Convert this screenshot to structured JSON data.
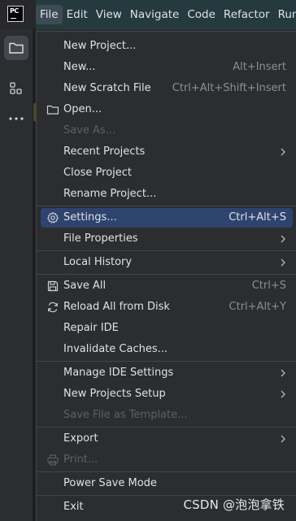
{
  "menubar": {
    "items": [
      {
        "label": "File",
        "active": true
      },
      {
        "label": "Edit"
      },
      {
        "label": "View"
      },
      {
        "label": "Navigate"
      },
      {
        "label": "Code"
      },
      {
        "label": "Refactor"
      },
      {
        "label": "Run"
      }
    ]
  },
  "app_logo": {
    "text": "PC"
  },
  "toolwindow": {
    "icons": [
      "folder-icon",
      "structure-icon",
      "more-icon"
    ]
  },
  "file_menu": {
    "items": [
      {
        "label": "New Project...",
        "shortcut": "",
        "submenu": false
      },
      {
        "label": "New...",
        "shortcut": "Alt+Insert",
        "submenu": false
      },
      {
        "label": "New Scratch File",
        "shortcut": "Ctrl+Alt+Shift+Insert",
        "submenu": false
      },
      {
        "label": "Open...",
        "shortcut": "",
        "icon": "folder-icon"
      },
      {
        "label": "Save As...",
        "shortcut": "",
        "disabled": true
      },
      {
        "label": "Recent Projects",
        "submenu": true
      },
      {
        "label": "Close Project"
      },
      {
        "label": "Rename Project..."
      },
      {
        "label": "Settings...",
        "shortcut": "Ctrl+Alt+S",
        "icon": "gear-icon",
        "selected": true
      },
      {
        "label": "File Properties",
        "submenu": true
      },
      {
        "label": "Local History",
        "submenu": true
      },
      {
        "label": "Save All",
        "shortcut": "Ctrl+S",
        "icon": "save-icon"
      },
      {
        "label": "Reload All from Disk",
        "shortcut": "Ctrl+Alt+Y",
        "icon": "reload-icon"
      },
      {
        "label": "Repair IDE"
      },
      {
        "label": "Invalidate Caches..."
      },
      {
        "label": "Manage IDE Settings",
        "submenu": true
      },
      {
        "label": "New Projects Setup",
        "submenu": true
      },
      {
        "label": "Save File as Template...",
        "disabled": true
      },
      {
        "label": "Export",
        "submenu": true
      },
      {
        "label": "Print...",
        "icon": "print-icon",
        "disabled": true
      },
      {
        "label": "Power Save Mode"
      },
      {
        "label": "Exit"
      }
    ]
  },
  "watermark": "CSDN @泡泡拿铁",
  "colors": {
    "menu_bg": "#2b2d30",
    "selected_bg": "#2e436e",
    "text": "#dfe1e5",
    "shortcut_text": "#8b8e94",
    "disabled_text": "#5d6066"
  }
}
